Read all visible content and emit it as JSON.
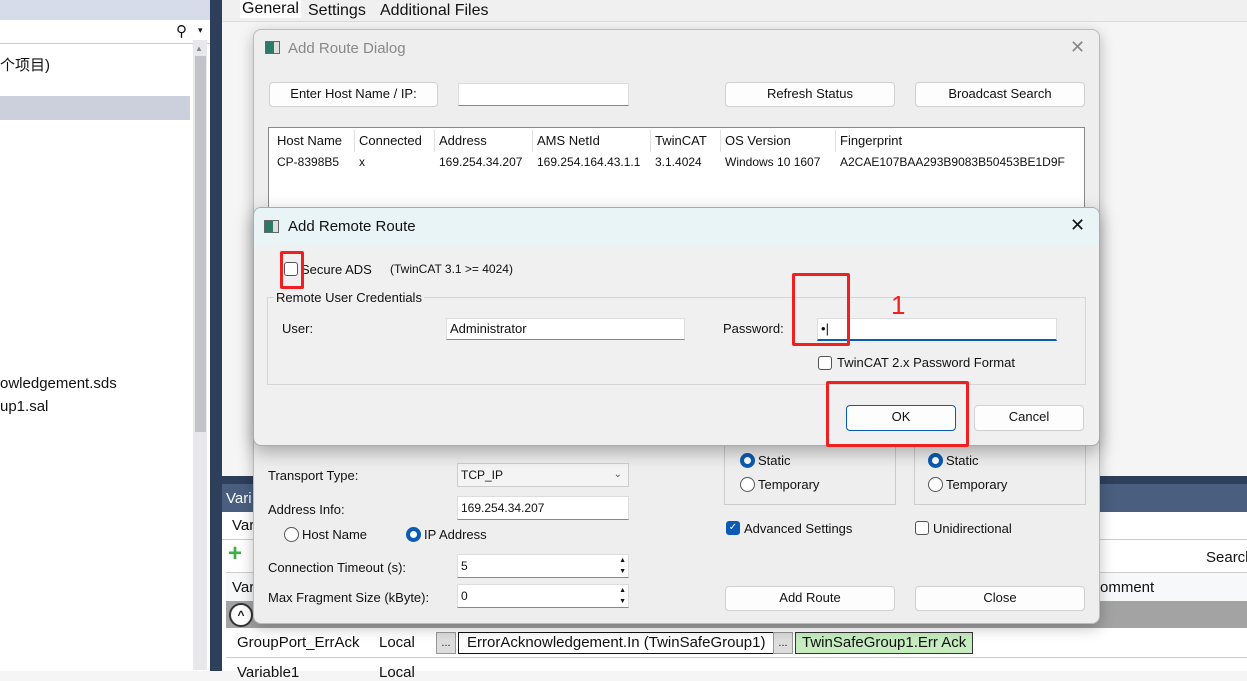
{
  "left_panel": {
    "items": [
      "个项目)",
      "owledgement.sds",
      "up1.sal"
    ]
  },
  "tabs": [
    "General",
    "Settings",
    "Additional Files"
  ],
  "add_route_dialog": {
    "title": "Add Route Dialog",
    "enter_host_button": "Enter Host Name / IP:",
    "host_input": "",
    "refresh_button": "Refresh Status",
    "broadcast_button": "Broadcast Search",
    "columns": [
      "Host Name",
      "Connected",
      "Address",
      "AMS NetId",
      "TwinCAT",
      "OS Version",
      "Fingerprint"
    ],
    "rows": [
      [
        "CP-8398B5",
        "x",
        "169.254.34.207",
        "169.254.164.43.1.1",
        "3.1.4024",
        "Windows 10 1607",
        "A2CAE107BAA293B9083B50453BE1D9F"
      ]
    ],
    "transport_label": "Transport Type:",
    "transport_value": "TCP_IP",
    "address_label": "Address Info:",
    "address_value": "169.254.34.207",
    "host_name_radio": "Host Name",
    "ip_address_radio": "IP Address",
    "timeout_label": "Connection Timeout (s):",
    "timeout_value": "5",
    "fragment_label": "Max Fragment Size (kByte):",
    "fragment_value": "0",
    "static1": "Static",
    "temporary1": "Temporary",
    "static2": "Static",
    "temporary2": "Temporary",
    "advanced_settings": "Advanced Settings",
    "advanced_checked": true,
    "unidirectional": "Unidirectional",
    "unidirectional_checked": false,
    "add_route_button": "Add Route",
    "close_button": "Close"
  },
  "remote_route": {
    "title": "Add Remote Route",
    "secure_ads": "Secure ADS",
    "secure_ads_note": "(TwinCAT 3.1 >= 4024)",
    "secure_checked": false,
    "group_label": "Remote User Credentials",
    "user_label": "User:",
    "user_value": "Administrator",
    "password_label": "Password:",
    "password_value": "•",
    "tc2_format": "TwinCAT 2.x Password Format",
    "ok_button": "OK",
    "cancel_button": "Cancel",
    "annotation": "1"
  },
  "bottom_panel": {
    "header": "Vari",
    "tab": "Var",
    "col": "Var",
    "search": "Search",
    "comment": "omment",
    "row": {
      "name": "GroupPort_ErrAck",
      "scope": "Local",
      "link1": "ErrorAcknowledgement.In (TwinSafeGroup1)",
      "link2": "TwinSafeGroup1.Err Ack",
      "dots": "..."
    },
    "row2": {
      "name": "Variable1",
      "scope": "Local"
    }
  },
  "colors": {
    "accent": "#0a5bb5",
    "annotation": "#f02020",
    "link_green": "#c6ecc0",
    "panel_blue": "#4a5f80"
  }
}
